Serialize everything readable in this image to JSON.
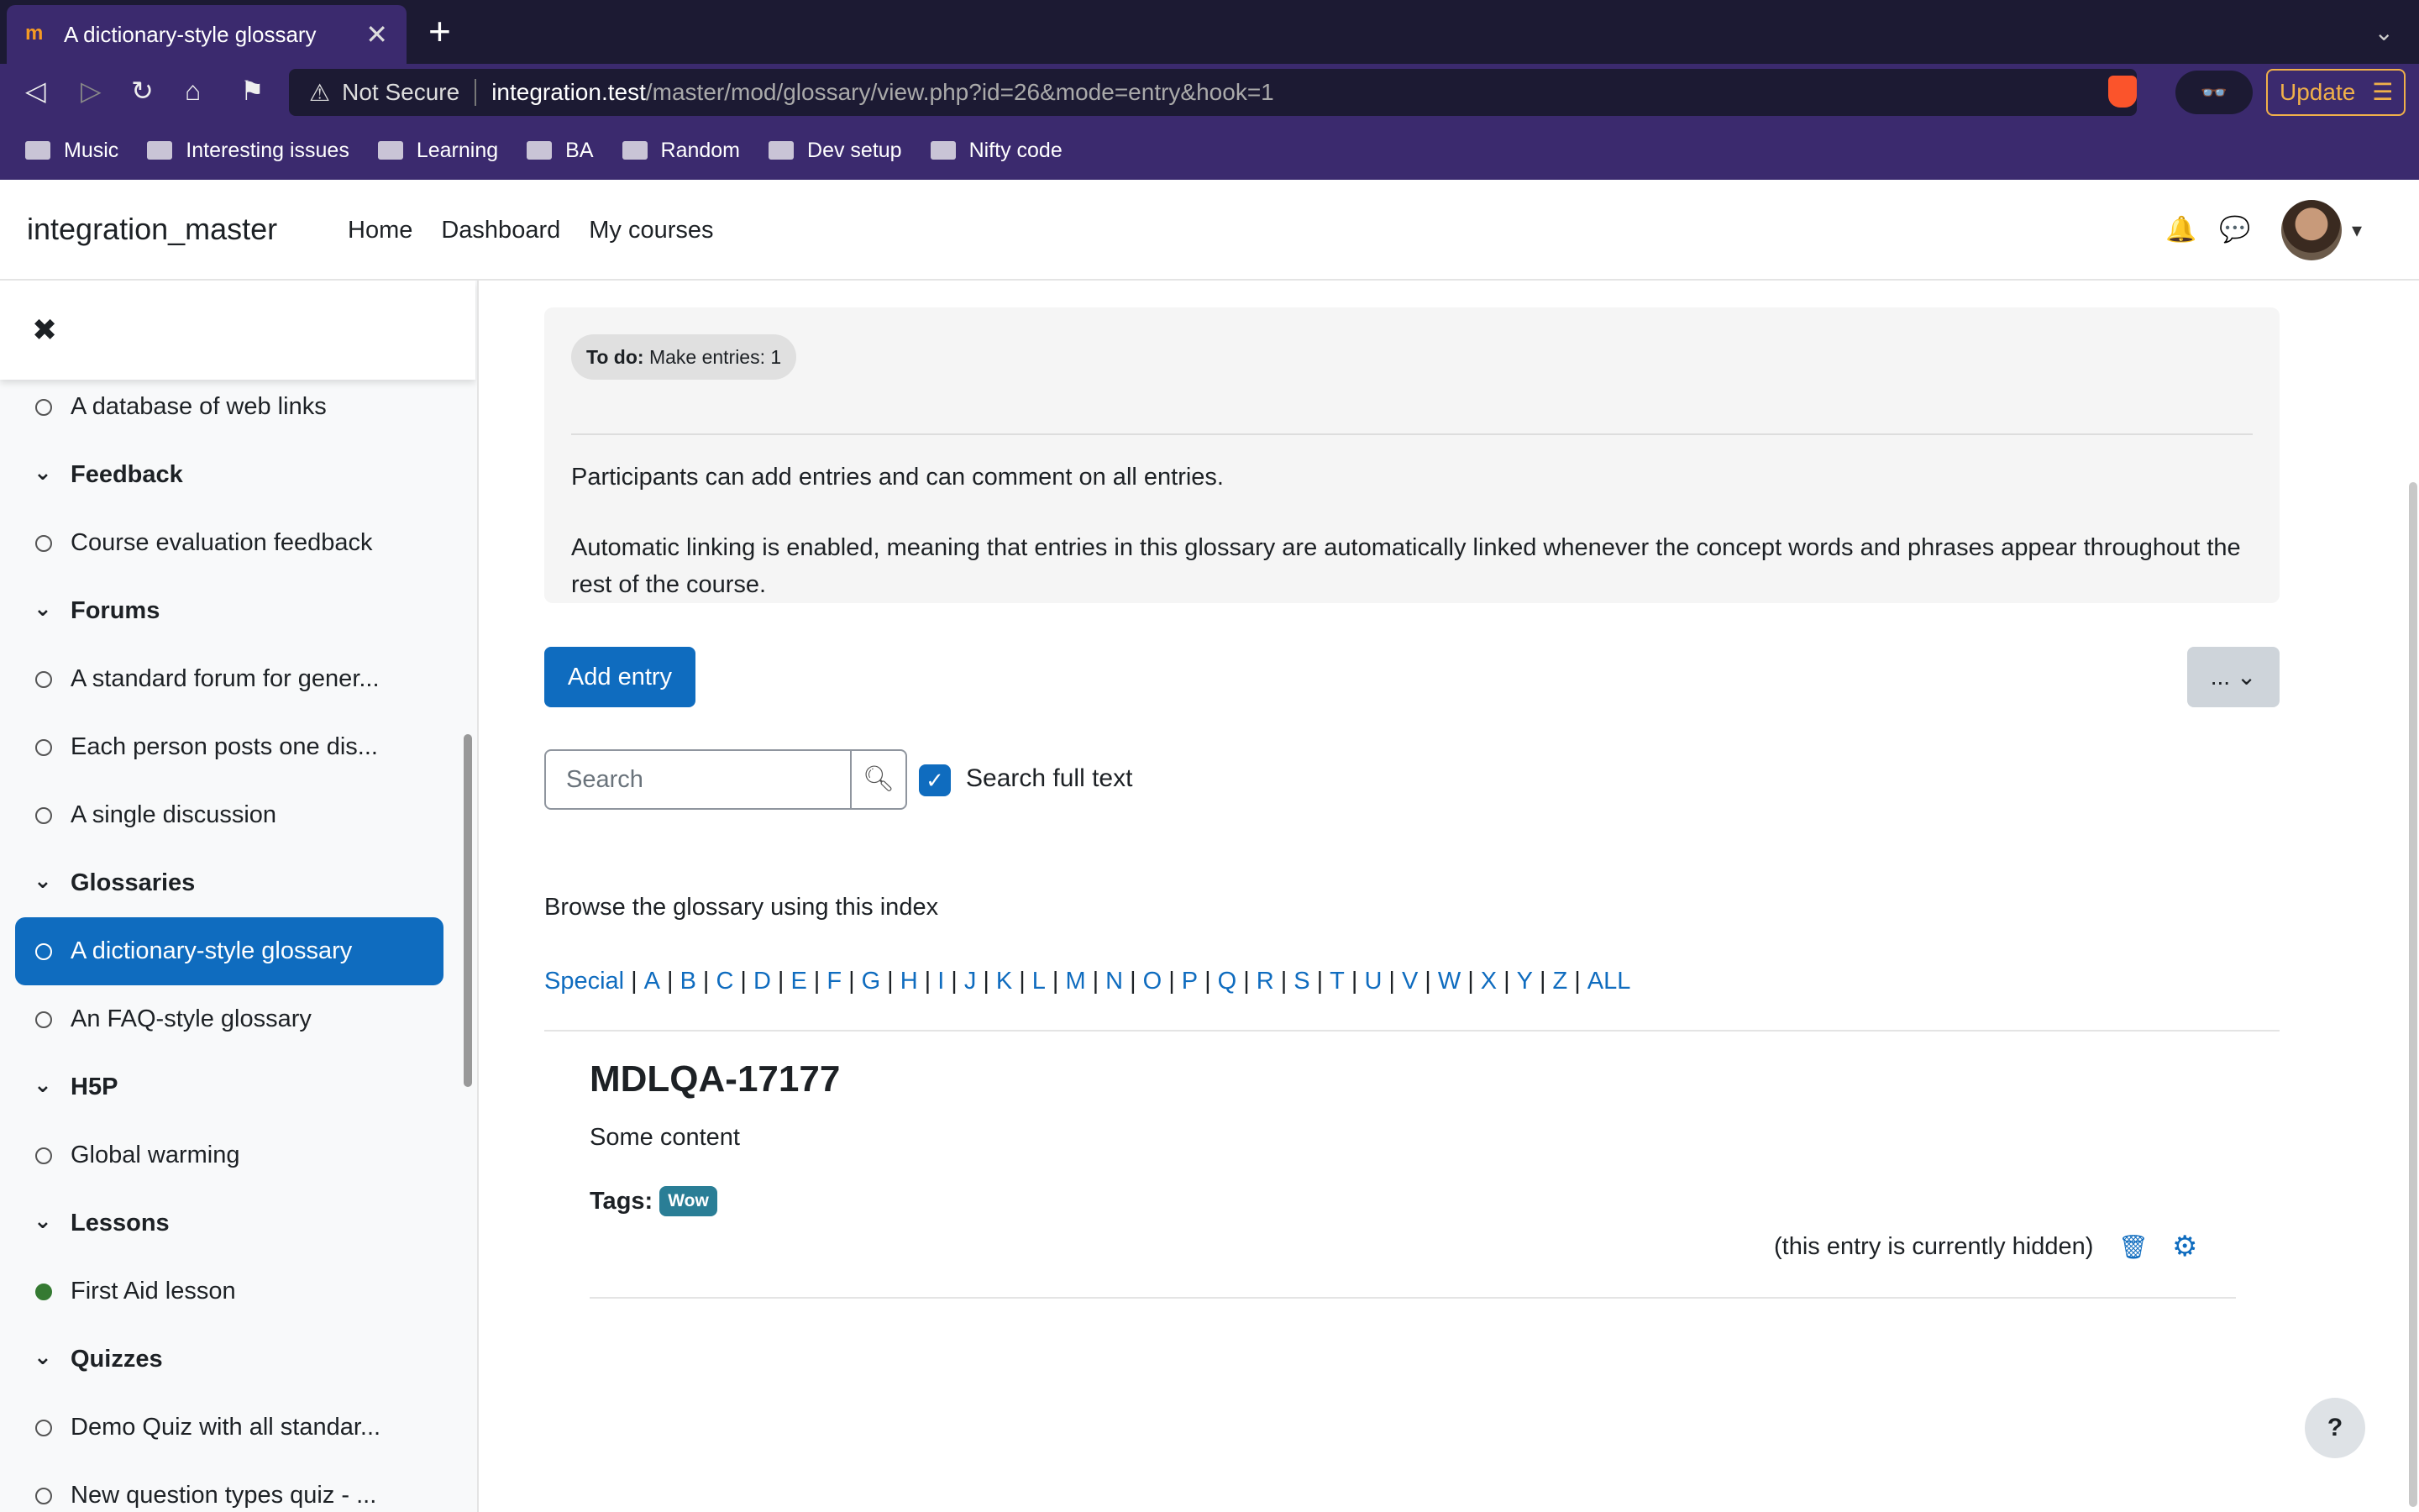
{
  "browser": {
    "tab_title": "A dictionary-style glossary",
    "tab_favicon": "m",
    "url_security": "Not Secure",
    "url_host": "integration.test",
    "url_path": "/master/mod/glossary/view.php?id=26&mode=entry&hook=1",
    "update_label": "Update",
    "bookmarks": [
      "Music",
      "Interesting issues",
      "Learning",
      "BA",
      "Random",
      "Dev setup",
      "Nifty code"
    ]
  },
  "navbar": {
    "site_name": "integration_master",
    "links": [
      "Home",
      "Dashboard",
      "My courses"
    ]
  },
  "drawer": {
    "items": [
      {
        "type": "activity",
        "label": "A database of web links"
      },
      {
        "type": "section",
        "label": "Feedback"
      },
      {
        "type": "activity",
        "label": "Course evaluation feedback"
      },
      {
        "type": "section",
        "label": "Forums"
      },
      {
        "type": "activity",
        "label": "A standard forum for gener..."
      },
      {
        "type": "activity",
        "label": "Each person posts one dis..."
      },
      {
        "type": "activity",
        "label": "A single discussion"
      },
      {
        "type": "section",
        "label": "Glossaries"
      },
      {
        "type": "activity",
        "label": "A dictionary-style glossary",
        "active": true
      },
      {
        "type": "activity",
        "label": "An FAQ-style glossary"
      },
      {
        "type": "section",
        "label": "H5P"
      },
      {
        "type": "activity",
        "label": "Global warming"
      },
      {
        "type": "section",
        "label": "Lessons"
      },
      {
        "type": "activity",
        "label": "First Aid lesson",
        "done": true
      },
      {
        "type": "section",
        "label": "Quizzes"
      },
      {
        "type": "activity",
        "label": "Demo Quiz with all standar..."
      },
      {
        "type": "activity",
        "label": "New question types quiz - ..."
      }
    ]
  },
  "main": {
    "todo_label": "To do:",
    "todo_text": "Make entries: 1",
    "intro_1": "Participants can add entries and can comment on all entries.",
    "intro_2": "Automatic linking is enabled, meaning that entries in this glossary are automatically linked whenever the concept words and phrases appear throughout the rest of the course.",
    "add_entry_label": "Add entry",
    "more_label": "...",
    "search_placeholder": "Search",
    "search_full_text_label": "Search full text",
    "search_full_text_checked": true,
    "browse_label": "Browse the glossary using this index",
    "index": [
      "Special",
      "A",
      "B",
      "C",
      "D",
      "E",
      "F",
      "G",
      "H",
      "I",
      "J",
      "K",
      "L",
      "M",
      "N",
      "O",
      "P",
      "Q",
      "R",
      "S",
      "T",
      "U",
      "V",
      "W",
      "X",
      "Y",
      "Z",
      "ALL"
    ],
    "entry": {
      "title": "MDLQA-17177",
      "content": "Some content",
      "tags_label": "Tags:",
      "tags": [
        "Wow"
      ],
      "hidden_note": "(this entry is currently hidden)"
    },
    "help_label": "?"
  },
  "colors": {
    "primary": "#0f6cbf",
    "browser_chrome": "#3b2a6e",
    "tag": "#2a7e96",
    "done": "#357a32"
  }
}
